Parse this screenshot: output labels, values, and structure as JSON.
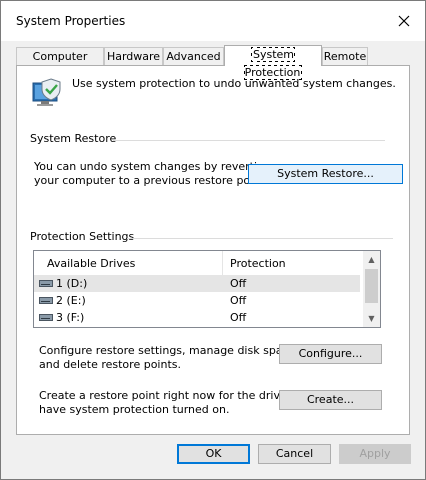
{
  "window": {
    "title": "System Properties"
  },
  "tabs": [
    {
      "label": "Computer Name"
    },
    {
      "label": "Hardware"
    },
    {
      "label": "Advanced"
    },
    {
      "label": "System Protection",
      "active": true
    },
    {
      "label": "Remote"
    }
  ],
  "intro": {
    "text": "Use system protection to undo unwanted system changes."
  },
  "system_restore": {
    "group_label": "System Restore",
    "description_line1": "You can undo system changes by reverting",
    "description_line2": "your computer to a previous restore point.",
    "button_label": "System Restore..."
  },
  "protection": {
    "group_label": "Protection Settings",
    "columns": {
      "drives": "Available Drives",
      "protection": "Protection"
    },
    "drives": [
      {
        "name": "1 (D:)",
        "protection": "Off",
        "selected": true
      },
      {
        "name": "2 (E:)",
        "protection": "Off"
      },
      {
        "name": "3 (F:)",
        "protection": "Off"
      }
    ],
    "configure_text_line1": "Configure restore settings, manage disk space,",
    "configure_text_line2": "and delete restore points.",
    "configure_button": "Configure...",
    "create_text_line1": "Create a restore point right now for the drives that",
    "create_text_line2": "have system protection turned on.",
    "create_button": "Create..."
  },
  "footer": {
    "ok": "OK",
    "cancel": "Cancel",
    "apply": "Apply"
  },
  "colors": {
    "accent": "#0078d7",
    "dialog_bg": "#f0f0f0",
    "selected_row": "#e5e5e5"
  }
}
